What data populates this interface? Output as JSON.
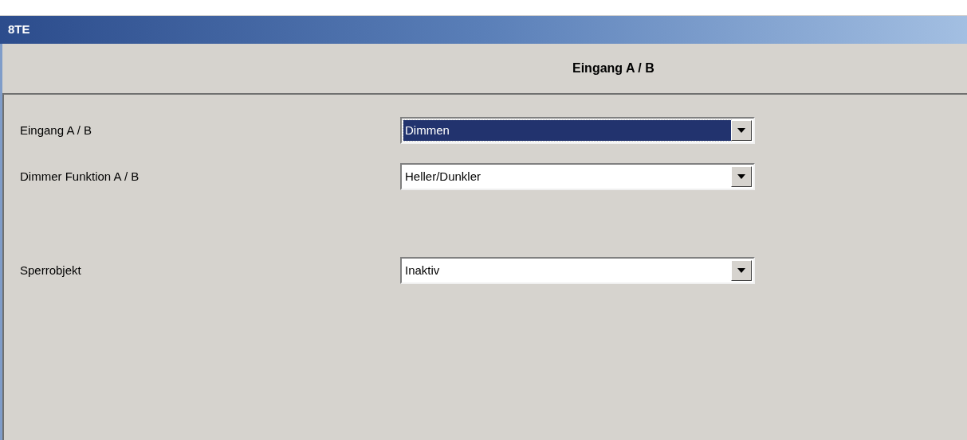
{
  "window": {
    "title": "8TE"
  },
  "header": {
    "title": "Eingang A / B"
  },
  "groups": [
    {
      "rows": [
        {
          "label": "Eingang A / B",
          "value": "Dimmen",
          "selected": true
        },
        {
          "label": "Dimmer Funktion A / B",
          "value": "Heller/Dunkler",
          "selected": false
        }
      ]
    },
    {
      "rows": [
        {
          "label": "Sperrobjekt",
          "value": "Inaktiv",
          "selected": false
        }
      ]
    }
  ]
}
